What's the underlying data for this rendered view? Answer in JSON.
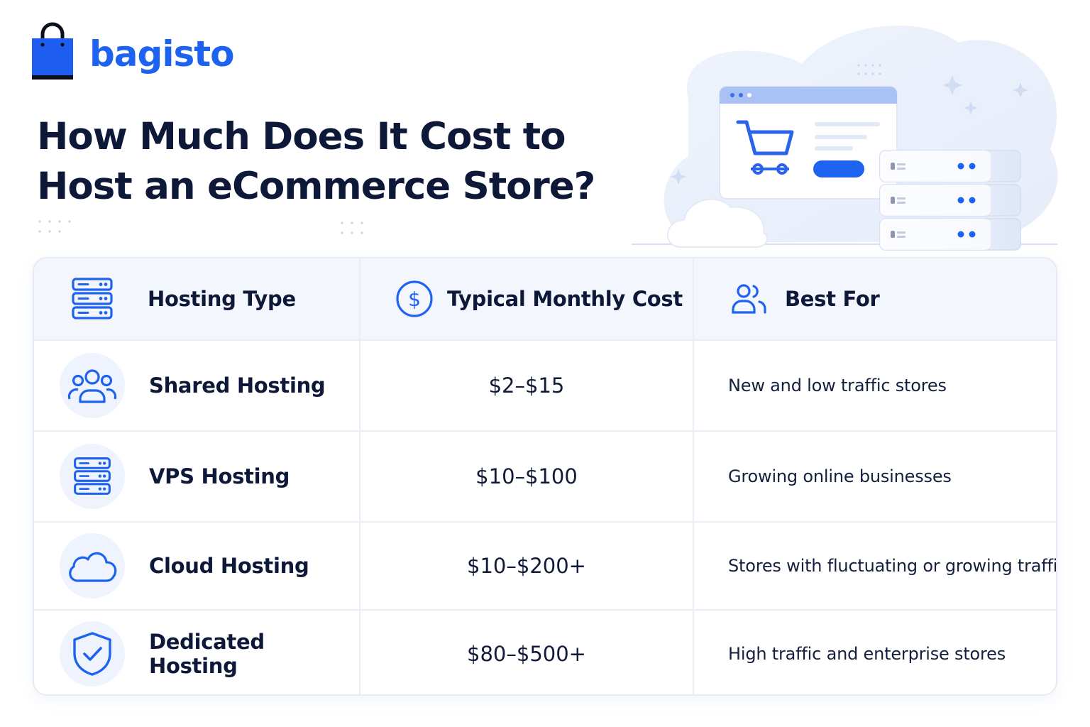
{
  "brand": {
    "name": "bagisto"
  },
  "title": "How Much Does It Cost to Host an eCommerce Store?",
  "colors": {
    "accent": "#1e63f0",
    "text": "#0e1838",
    "header_bg": "#f3f6fd",
    "icon_badge_bg": "#eef3fd"
  },
  "table": {
    "headers": [
      {
        "label": "Hosting Type",
        "icon": "server-icon"
      },
      {
        "label": "Typical Monthly Cost",
        "icon": "dollar-circle-icon"
      },
      {
        "label": "Best For",
        "icon": "users-icon"
      }
    ],
    "rows": [
      {
        "type": "Shared Hosting",
        "cost": "$2–$15",
        "best_for": "New and low traffic stores",
        "icon": "users-group-icon"
      },
      {
        "type": "VPS Hosting",
        "cost": "$10–$100",
        "best_for": "Growing online businesses",
        "icon": "server-icon"
      },
      {
        "type": "Cloud Hosting",
        "cost": "$10–$200+",
        "best_for": "Stores with fluctuating or growing traffic",
        "icon": "cloud-icon"
      },
      {
        "type": "Dedicated Hosting",
        "cost": "$80–$500+",
        "best_for": "High traffic and enterprise stores",
        "icon": "shield-check-icon"
      }
    ]
  }
}
